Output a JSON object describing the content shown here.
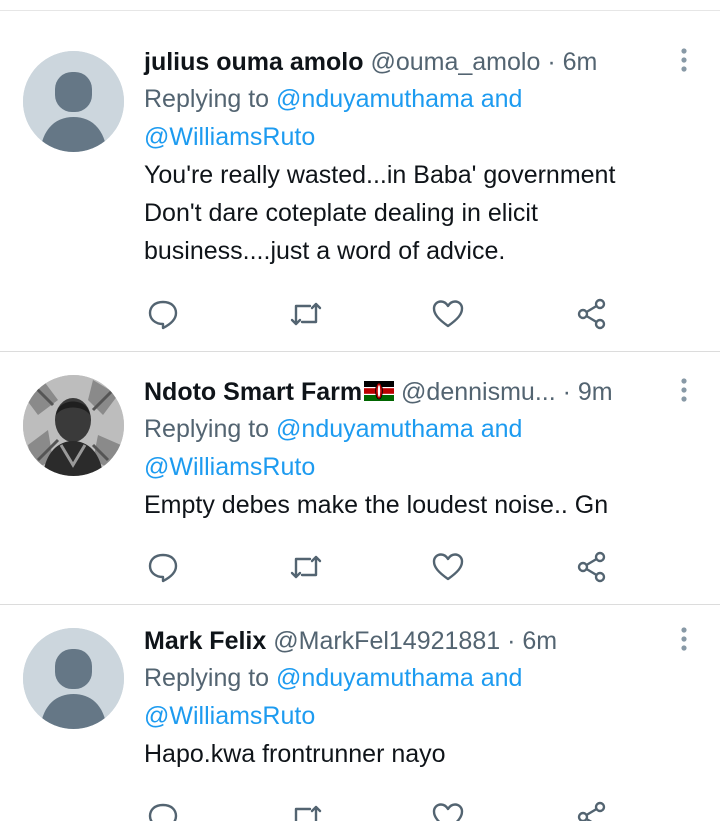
{
  "tweets": [
    {
      "name": "julius ouma amolo",
      "handle": "@ouma_amolo",
      "separator": "·",
      "time": "6m",
      "replying_prefix": "Replying to",
      "mention1": "@nduyamuthama",
      "conjunction": "and",
      "mention2": "@WilliamsRuto",
      "text_lines": [
        "You're really wasted...in Baba' government",
        "Don't dare coteplate dealing in elicit",
        "business....just a word of advice."
      ],
      "avatar": "default-avatar"
    },
    {
      "name": "Ndoto Smart Farm",
      "flag": "kenya-flag",
      "handle": "@dennismu...",
      "separator": "·",
      "time": "9m",
      "replying_prefix": "Replying to",
      "mention1": "@nduyamuthama",
      "conjunction": "and",
      "mention2": "@WilliamsRuto",
      "text_lines": [
        "Empty debes make the loudest noise.. Gn"
      ],
      "avatar": "photo-avatar"
    },
    {
      "name": "Mark Felix",
      "handle": "@MarkFel14921881",
      "separator": "·",
      "time": "6m",
      "replying_prefix": "Replying to",
      "mention1": "@nduyamuthama",
      "conjunction": "and",
      "mention2": "@WilliamsRuto",
      "text_lines": [
        "Hapo.kwa frontrunner nayo"
      ],
      "avatar": "default-avatar"
    }
  ],
  "icons": {
    "reply": "reply-icon",
    "retweet": "retweet-icon",
    "like": "heart-icon",
    "share": "share-icon",
    "more": "more-vertical-icon"
  },
  "colors": {
    "text": "#0f1419",
    "secondary": "#536471",
    "link": "#1d9bf0",
    "avatar_bg": "#ccd6dd",
    "avatar_fg": "#657786"
  }
}
